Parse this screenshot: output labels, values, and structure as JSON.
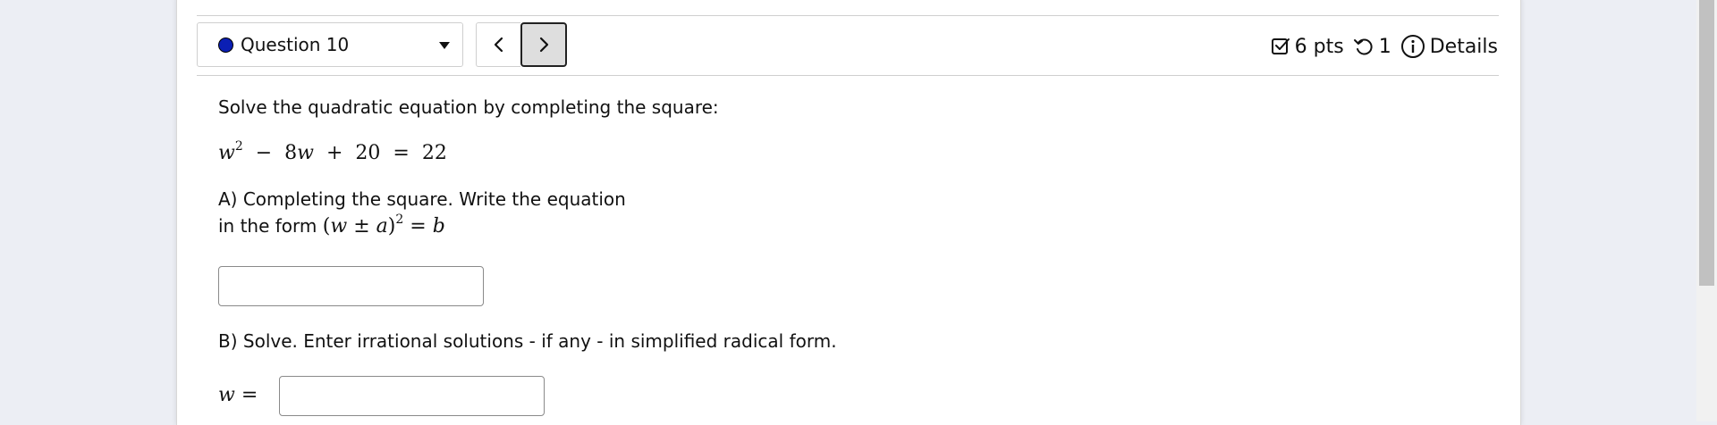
{
  "question_nav": {
    "selected_question": "Question 10",
    "status_color": "#0b1fb4"
  },
  "meta": {
    "points": "6 pts",
    "attempts": "1",
    "details_label": "Details"
  },
  "problem": {
    "instruction": "Solve the quadratic equation by completing the square:",
    "part_a_line1": "A) Completing the square. Write the equation",
    "part_a_line2": "in the form",
    "part_b": "B) Solve. Enter irrational solutions - if any - in simplified radical form.",
    "answer_a_value": "",
    "answer_b_value": ""
  },
  "icons": {
    "status": "filled-circle",
    "dropdown": "caret-down-icon",
    "prev": "chevron-left-icon",
    "next": "chevron-right-icon",
    "points": "checkbox-icon",
    "attempts": "retry-icon",
    "details": "info-icon"
  }
}
